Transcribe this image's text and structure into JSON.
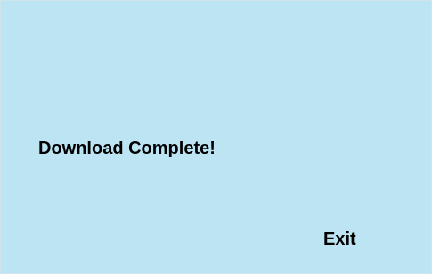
{
  "dialog": {
    "message": "Download Complete!",
    "exit_label": "Exit"
  },
  "colors": {
    "background": "#bde4f2",
    "text": "#000000"
  }
}
